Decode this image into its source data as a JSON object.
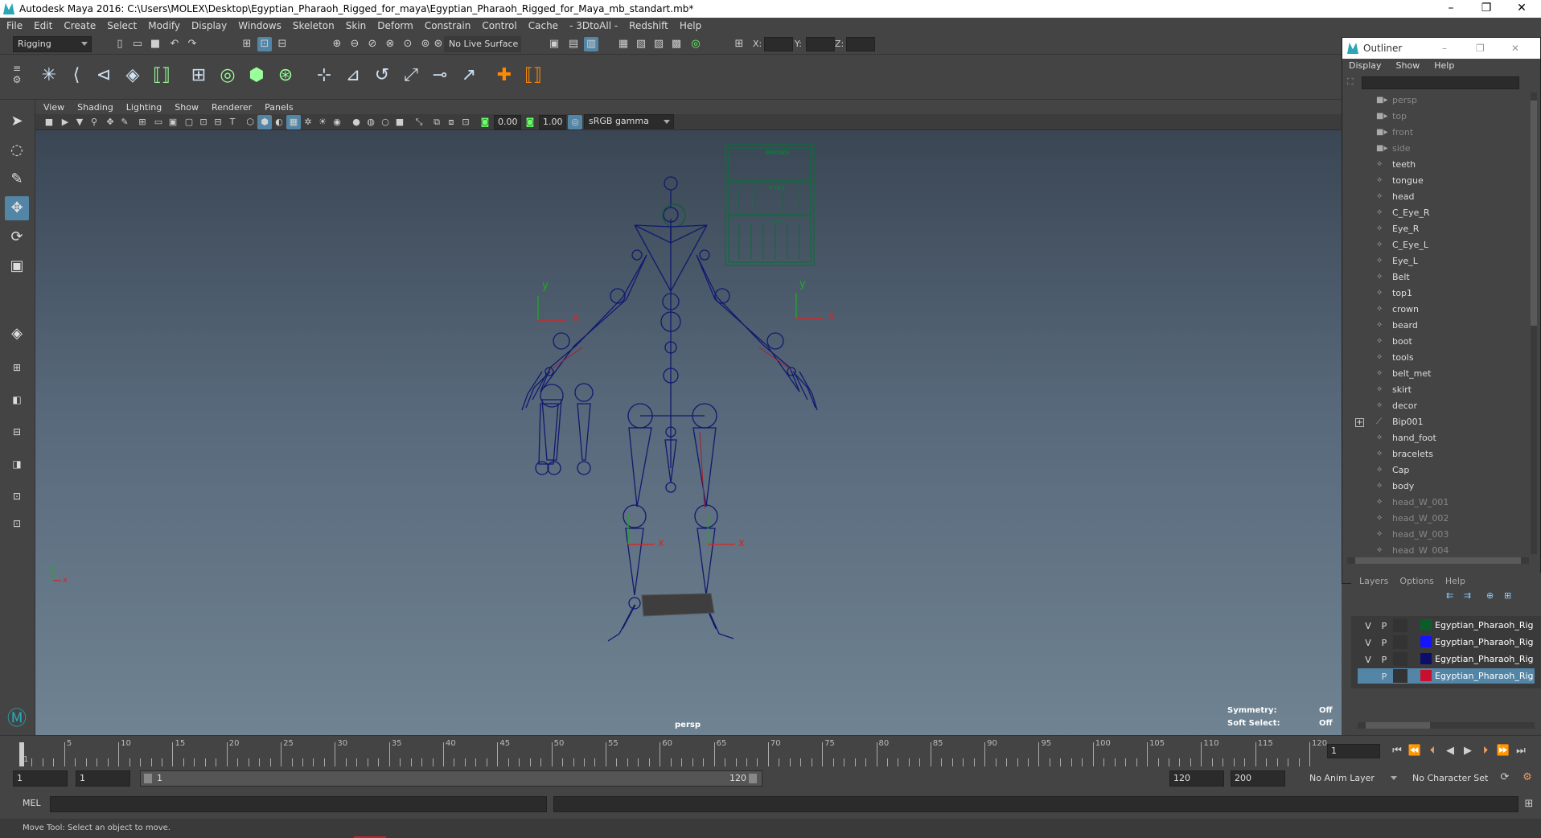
{
  "window": {
    "title": "Autodesk Maya 2016: C:\\Users\\MOLEX\\Desktop\\Egyptian_Pharaoh_Rigged_for_maya\\Egyptian_Pharaoh_Rigged_for_Maya_mb_standart.mb*",
    "minimize": "–",
    "restore": "❐",
    "close": "✕"
  },
  "menubar": [
    "File",
    "Edit",
    "Create",
    "Select",
    "Modify",
    "Display",
    "Windows",
    "Skeleton",
    "Skin",
    "Deform",
    "Constrain",
    "Control",
    "Cache",
    "- 3DtoAll -",
    "Redshift",
    "Help"
  ],
  "statusline": {
    "menuset": "Rigging",
    "live_surface": "No Live Surface",
    "x_label": "X:",
    "y_label": "Y:",
    "z_label": "Z:"
  },
  "panel": {
    "menus": [
      "View",
      "Shading",
      "Lighting",
      "Show",
      "Renderer",
      "Panels"
    ],
    "exposure": "0.00",
    "gamma": "1.00",
    "color_space": "sRGB gamma"
  },
  "viewport": {
    "camera_label": "persp",
    "hud_symmetry_label": "Symmetry:",
    "hud_symmetry_value": "Off",
    "hud_soft_label": "Soft Select:",
    "hud_soft_value": "Off",
    "axis_y": "y",
    "axis_x": "x",
    "axis_z": "z",
    "panel_labels": [
      "BROWS",
      "EYES",
      "LIPS"
    ]
  },
  "outliner": {
    "title": "Outliner",
    "menus": [
      "Display",
      "Show",
      "Help"
    ],
    "items": [
      {
        "label": "persp",
        "icon": "camera-icon",
        "dim": true
      },
      {
        "label": "top",
        "icon": "camera-icon",
        "dim": true
      },
      {
        "label": "front",
        "icon": "camera-icon",
        "dim": true
      },
      {
        "label": "side",
        "icon": "camera-icon",
        "dim": true
      },
      {
        "label": "teeth",
        "icon": "mesh-icon",
        "dim": false
      },
      {
        "label": "tongue",
        "icon": "mesh-icon",
        "dim": false
      },
      {
        "label": "head",
        "icon": "mesh-icon",
        "dim": false
      },
      {
        "label": "C_Eye_R",
        "icon": "mesh-icon",
        "dim": false
      },
      {
        "label": "Eye_R",
        "icon": "mesh-icon",
        "dim": false
      },
      {
        "label": "C_Eye_L",
        "icon": "mesh-icon",
        "dim": false
      },
      {
        "label": "Eye_L",
        "icon": "mesh-icon",
        "dim": false
      },
      {
        "label": "Belt",
        "icon": "mesh-icon",
        "dim": false
      },
      {
        "label": "top1",
        "icon": "mesh-icon",
        "dim": false
      },
      {
        "label": "crown",
        "icon": "mesh-icon",
        "dim": false
      },
      {
        "label": "beard",
        "icon": "mesh-icon",
        "dim": false
      },
      {
        "label": "boot",
        "icon": "mesh-icon",
        "dim": false
      },
      {
        "label": "tools",
        "icon": "mesh-icon",
        "dim": false
      },
      {
        "label": "belt_met",
        "icon": "mesh-icon",
        "dim": false
      },
      {
        "label": "skirt",
        "icon": "mesh-icon",
        "dim": false
      },
      {
        "label": "decor",
        "icon": "mesh-icon",
        "dim": false
      },
      {
        "label": "Bip001",
        "icon": "joint-icon",
        "dim": false,
        "expandable": true
      },
      {
        "label": "hand_foot",
        "icon": "mesh-icon",
        "dim": false
      },
      {
        "label": "bracelets",
        "icon": "mesh-icon",
        "dim": false
      },
      {
        "label": "Cap",
        "icon": "mesh-icon",
        "dim": false
      },
      {
        "label": "body",
        "icon": "mesh-icon",
        "dim": false
      },
      {
        "label": "head_W_001",
        "icon": "mesh-icon",
        "dim": true
      },
      {
        "label": "head_W_002",
        "icon": "mesh-icon",
        "dim": true
      },
      {
        "label": "head_W_003",
        "icon": "mesh-icon",
        "dim": true
      },
      {
        "label": "head_W_004",
        "icon": "mesh-icon",
        "dim": true
      }
    ]
  },
  "layers": {
    "menus": [
      "Layers",
      "Options",
      "Help"
    ],
    "rows": [
      {
        "v": "V",
        "p": "P",
        "color": "#0b5c2a",
        "name": "Egyptian_Pharaoh_Rig"
      },
      {
        "v": "V",
        "p": "P",
        "color": "#1414ff",
        "name": "Egyptian_Pharaoh_Rig"
      },
      {
        "v": "V",
        "p": "P",
        "color": "#0d0d6e",
        "name": "Egyptian_Pharaoh_Rig"
      },
      {
        "v": "",
        "p": "P",
        "color": "#c8102e",
        "name": "Egyptian_Pharaoh_Rig"
      }
    ]
  },
  "timeslider": {
    "ticks": [
      "1",
      "5",
      "10",
      "15",
      "20",
      "25",
      "30",
      "35",
      "40",
      "45",
      "50",
      "55",
      "60",
      "65",
      "70",
      "75",
      "80",
      "85",
      "90",
      "95",
      "100",
      "105",
      "110",
      "115",
      "120"
    ],
    "current_frame": "1"
  },
  "rangeslider": {
    "start": "1",
    "playback_start": "1",
    "range_start_label": "1",
    "range_end_label": "120",
    "playback_end": "120",
    "end": "200",
    "anim_layer": "No Anim Layer",
    "character_set": "No Character Set"
  },
  "cmdline": {
    "language": "MEL"
  },
  "helpline": {
    "text": "Move Tool: Select an object to move."
  }
}
